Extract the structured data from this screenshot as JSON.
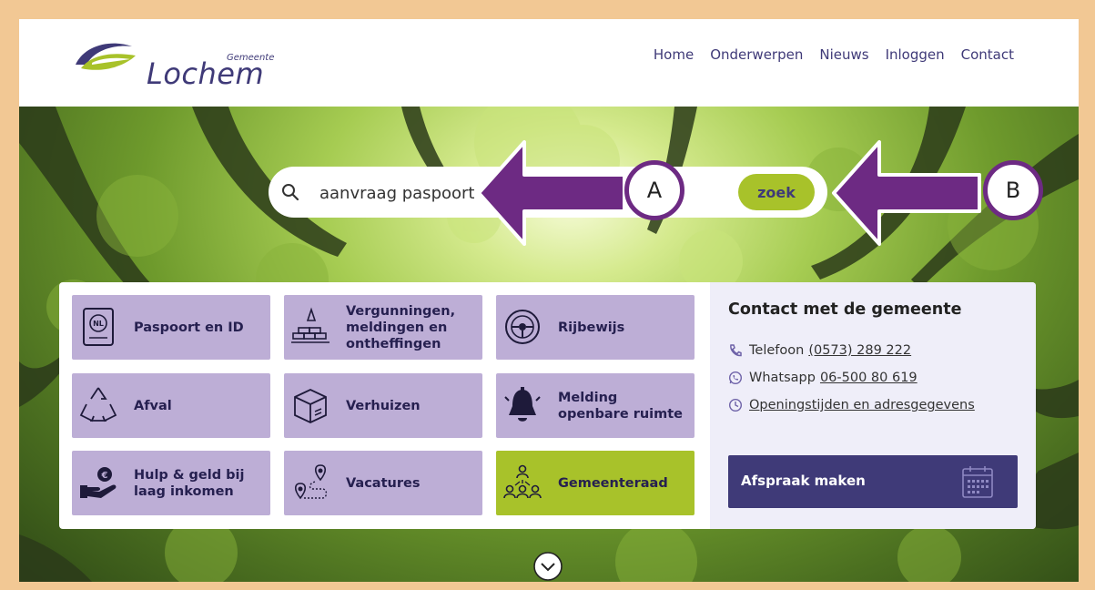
{
  "logo": {
    "small_text": "Gemeente",
    "name": "Lochem",
    "icon": "lochem-swoosh-logo"
  },
  "nav": {
    "items": [
      {
        "label": "Home"
      },
      {
        "label": "Onderwerpen"
      },
      {
        "label": "Nieuws"
      },
      {
        "label": "Inloggen"
      },
      {
        "label": "Contact"
      }
    ]
  },
  "search": {
    "value": "aanvraag paspoort",
    "button_label": "zoek",
    "icon": "search-icon"
  },
  "tiles": [
    {
      "label": "Paspoort en ID",
      "icon": "passport-icon",
      "color": "#bdaed6"
    },
    {
      "label": "Vergunningen, meldingen en ontheffingen",
      "icon": "construction-icon",
      "color": "#bdaed6"
    },
    {
      "label": "Rijbewijs",
      "icon": "steering-wheel-icon",
      "color": "#bdaed6"
    },
    {
      "label": "Afval",
      "icon": "recycle-icon",
      "color": "#bdaed6"
    },
    {
      "label": "Verhuizen",
      "icon": "moving-box-icon",
      "color": "#bdaed6"
    },
    {
      "label": "Melding openbare ruimte",
      "icon": "bell-icon",
      "color": "#bdaed6"
    },
    {
      "label": "Hulp & geld bij laag inkomen",
      "icon": "hand-coin-icon",
      "color": "#bdaed6"
    },
    {
      "label": "Vacatures",
      "icon": "route-pins-icon",
      "color": "#bdaed6"
    },
    {
      "label": "Gemeenteraad",
      "icon": "council-people-icon",
      "color": "#a8c22a"
    }
  ],
  "contact": {
    "title": "Contact met de gemeente",
    "phone_label": "Telefoon",
    "phone_value": "(0573) 289 222",
    "whatsapp_label": "Whatsapp",
    "whatsapp_value": "06-500 80 619",
    "hours_link": "Openingstijden en adresgegevens",
    "appointment_label": "Afspraak maken"
  },
  "annotations": [
    {
      "label": "A"
    },
    {
      "label": "B"
    }
  ],
  "colors": {
    "brand": "#3f3a78",
    "accent_green": "#a8c22a",
    "tile_purple": "#bdaed6",
    "arrow_purple": "#6d2a83",
    "border": "#f2c894"
  }
}
